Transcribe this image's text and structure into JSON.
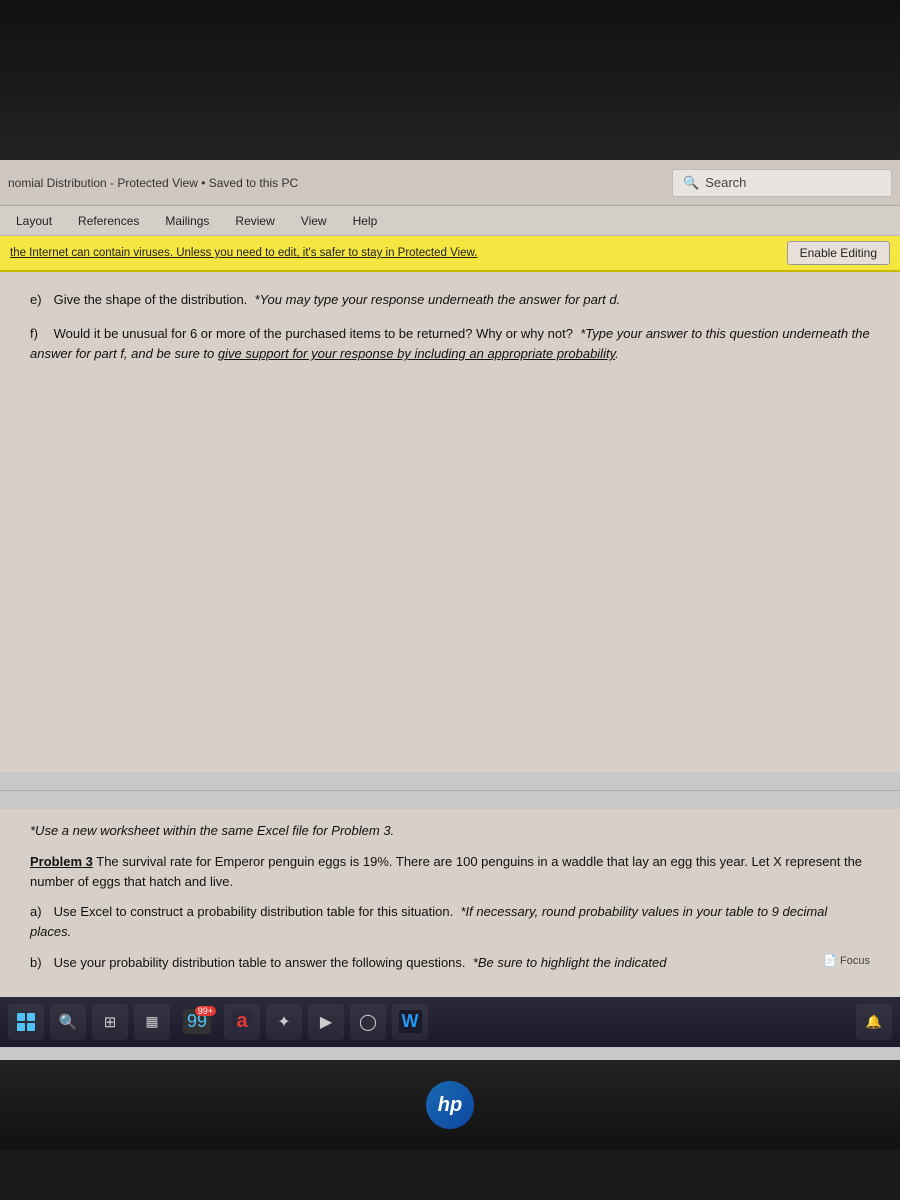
{
  "title_bar": {
    "title": "nomial Distribution - Protected View • Saved to this PC",
    "search_placeholder": "Search",
    "search_label": "Search"
  },
  "menu": {
    "items": [
      "Layout",
      "References",
      "Mailings",
      "Review",
      "View",
      "Help"
    ]
  },
  "protected_bar": {
    "message": "the Internet can contain viruses. Unless you need to edit, it's safer to stay in Protected View.",
    "button_label": "Enable Editing"
  },
  "document": {
    "section_e_label": "e)",
    "section_e_text": "Give the shape of the distribution.",
    "section_e_note": "*You may type your response underneath the answer for part d.",
    "section_f_label": "f)",
    "section_f_text": "Would it be unusual for 6 or more of the purchased items to be returned?  Why or why not?",
    "section_f_note": "*Type your answer to this question underneath the answer for part f, and be sure to give support for your response by including an appropriate probability.",
    "divider": true,
    "worksheet_note": "*Use a new worksheet within the same Excel file for Problem 3.",
    "problem3_text": "Problem 3 The survival rate for Emperor penguin eggs is 19%.  There are 100 penguins in a waddle that lay an egg this year.  Let X represent the number of eggs that hatch and live.",
    "section_a_label": "a)",
    "section_a_text": "Use Excel to construct a probability distribution table for this situation.",
    "section_a_note": "*If necessary, round probability values in your table to 9 decimal places.",
    "section_b_label": "b)",
    "section_b_text": "Use your probability distribution table to answer the following questions.",
    "section_b_note": "*Be sure to highlight the indicated",
    "focus_label": "Focus"
  },
  "taskbar": {
    "start_tooltip": "Start",
    "search_tooltip": "Search",
    "task_view_tooltip": "Task View",
    "widgets_tooltip": "Widgets",
    "chat_tooltip": "Chat",
    "store_badge": "99+",
    "word_tooltip": "Word",
    "focus_label": "Focus"
  },
  "hp_logo": "hp"
}
